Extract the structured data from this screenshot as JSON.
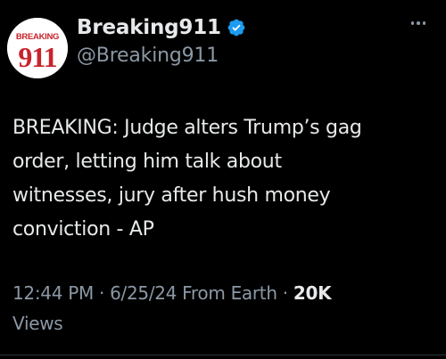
{
  "author": {
    "display_name": "Breaking911",
    "handle": "@Breaking911",
    "avatar_top_text": "BREAKING",
    "avatar_number": "911",
    "verified_color": "#1d9bf0",
    "avatar_color": "#c8232c"
  },
  "tweet": {
    "text": "BREAKING: Judge alters Trump’s gag\norder, letting him talk about\nwitnesses, jury after hush money\nconviction - AP"
  },
  "meta": {
    "time": "12:44 PM",
    "separator": "·",
    "date": "6/25/24",
    "source": "From Earth",
    "views_count": "20K",
    "views_label": "Views"
  },
  "icons": {
    "verified": "verified-badge-icon",
    "more": "more-options-icon"
  }
}
